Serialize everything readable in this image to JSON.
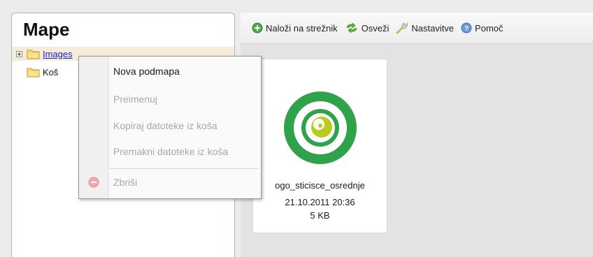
{
  "panel": {
    "title": "Mape",
    "tree": [
      {
        "label": "Images",
        "link": true
      },
      {
        "label": "Koš"
      }
    ]
  },
  "toolbar": {
    "upload_label": "Naloži na strežnik",
    "refresh_label": "Osveži",
    "settings_label": "Nastavitve",
    "help_label": "Pomoč"
  },
  "file": {
    "name": "ogo_sticisce_osrednje",
    "date": "21.10.2011 20:36",
    "size": "5 KB"
  },
  "context_menu": {
    "items": [
      {
        "label": "Nova podmapa",
        "enabled": true
      },
      {
        "label": "Preimenuj",
        "enabled": false
      },
      {
        "label": "Kopiraj datoteke iz koša",
        "enabled": false
      },
      {
        "label": "Premakni datoteke iz koša",
        "enabled": false
      },
      {
        "label": "Zbriši",
        "enabled": false
      }
    ]
  },
  "colors": {
    "link": "#1b22d6",
    "selected_row": "#f5ecd9",
    "logo_green": "#3aa14a",
    "logo_lime": "#a9c51c"
  }
}
